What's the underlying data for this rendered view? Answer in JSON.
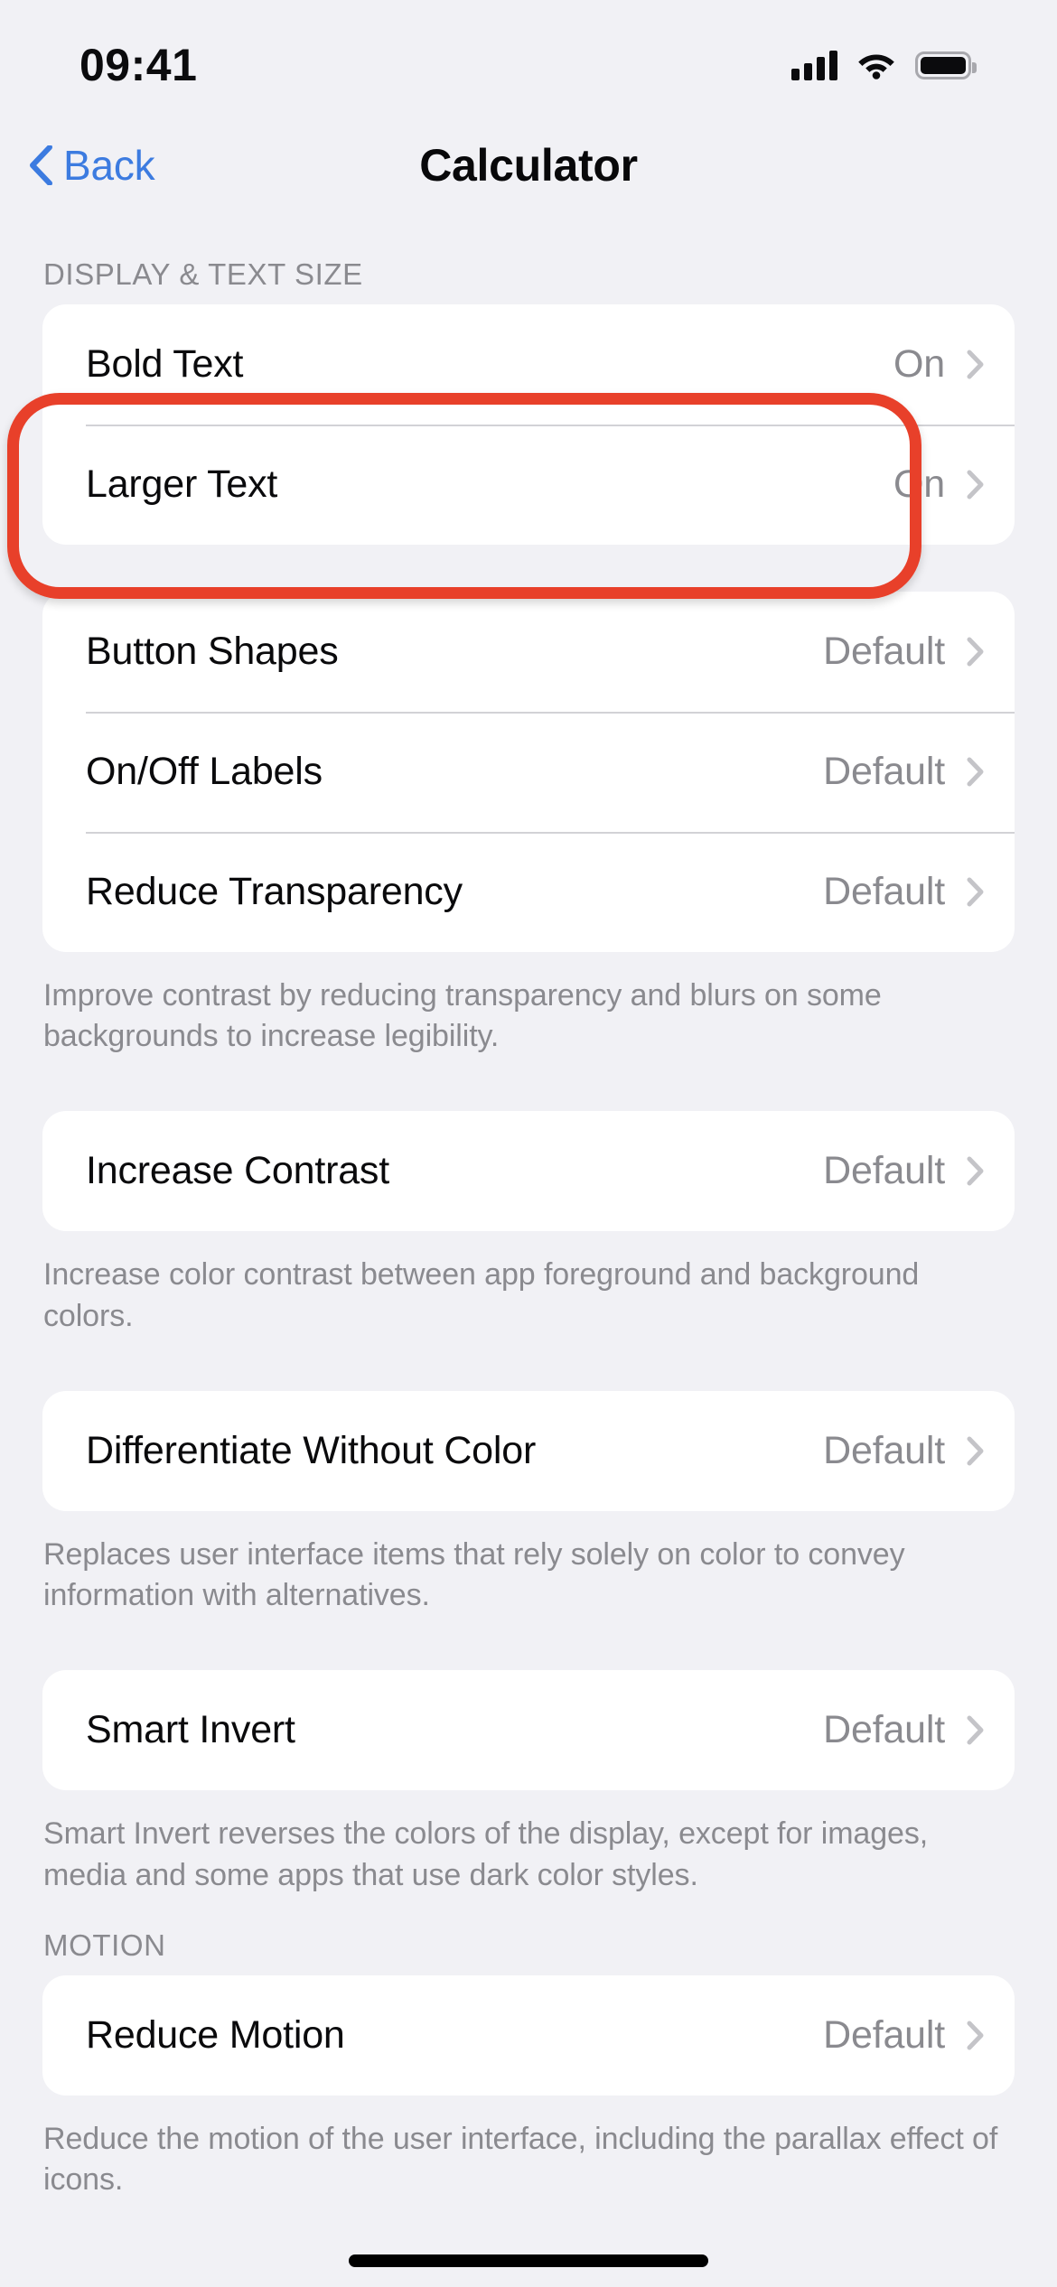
{
  "status_bar": {
    "time": "09:41",
    "cellular_icon": "cellular-bars-icon",
    "wifi_icon": "wifi-icon",
    "battery_icon": "battery-full-icon"
  },
  "nav": {
    "back_label": "Back",
    "back_icon": "chevron-left-icon",
    "title": "Calculator"
  },
  "sections": [
    {
      "header": "DISPLAY & TEXT SIZE",
      "rows": [
        {
          "label": "Bold Text",
          "value": "On"
        },
        {
          "label": "Larger Text",
          "value": "On"
        }
      ]
    },
    {
      "rows": [
        {
          "label": "Button Shapes",
          "value": "Default"
        },
        {
          "label": "On/Off Labels",
          "value": "Default"
        },
        {
          "label": "Reduce Transparency",
          "value": "Default"
        }
      ],
      "footnote": "Improve contrast by reducing transparency and blurs on some backgrounds to increase legibility."
    },
    {
      "rows": [
        {
          "label": "Increase Contrast",
          "value": "Default"
        }
      ],
      "footnote": "Increase color contrast between app foreground and background colors."
    },
    {
      "rows": [
        {
          "label": "Differentiate Without Color",
          "value": "Default"
        }
      ],
      "footnote": "Replaces user interface items that rely solely on color to convey information with alternatives."
    },
    {
      "rows": [
        {
          "label": "Smart Invert",
          "value": "Default"
        }
      ],
      "footnote": "Smart Invert reverses the colors of the display, except for images, media and some apps that use dark color styles."
    },
    {
      "header": "MOTION",
      "rows": [
        {
          "label": "Reduce Motion",
          "value": "Default"
        }
      ],
      "footnote": "Reduce the motion of the user interface, including the parallax effect of icons."
    }
  ],
  "colors": {
    "accent_blue": "#3C7BE0",
    "highlight_red": "#E8402A",
    "page_background": "#F1F1F5",
    "card_background": "#FFFFFF",
    "secondary_text": "#8A8A8F"
  }
}
